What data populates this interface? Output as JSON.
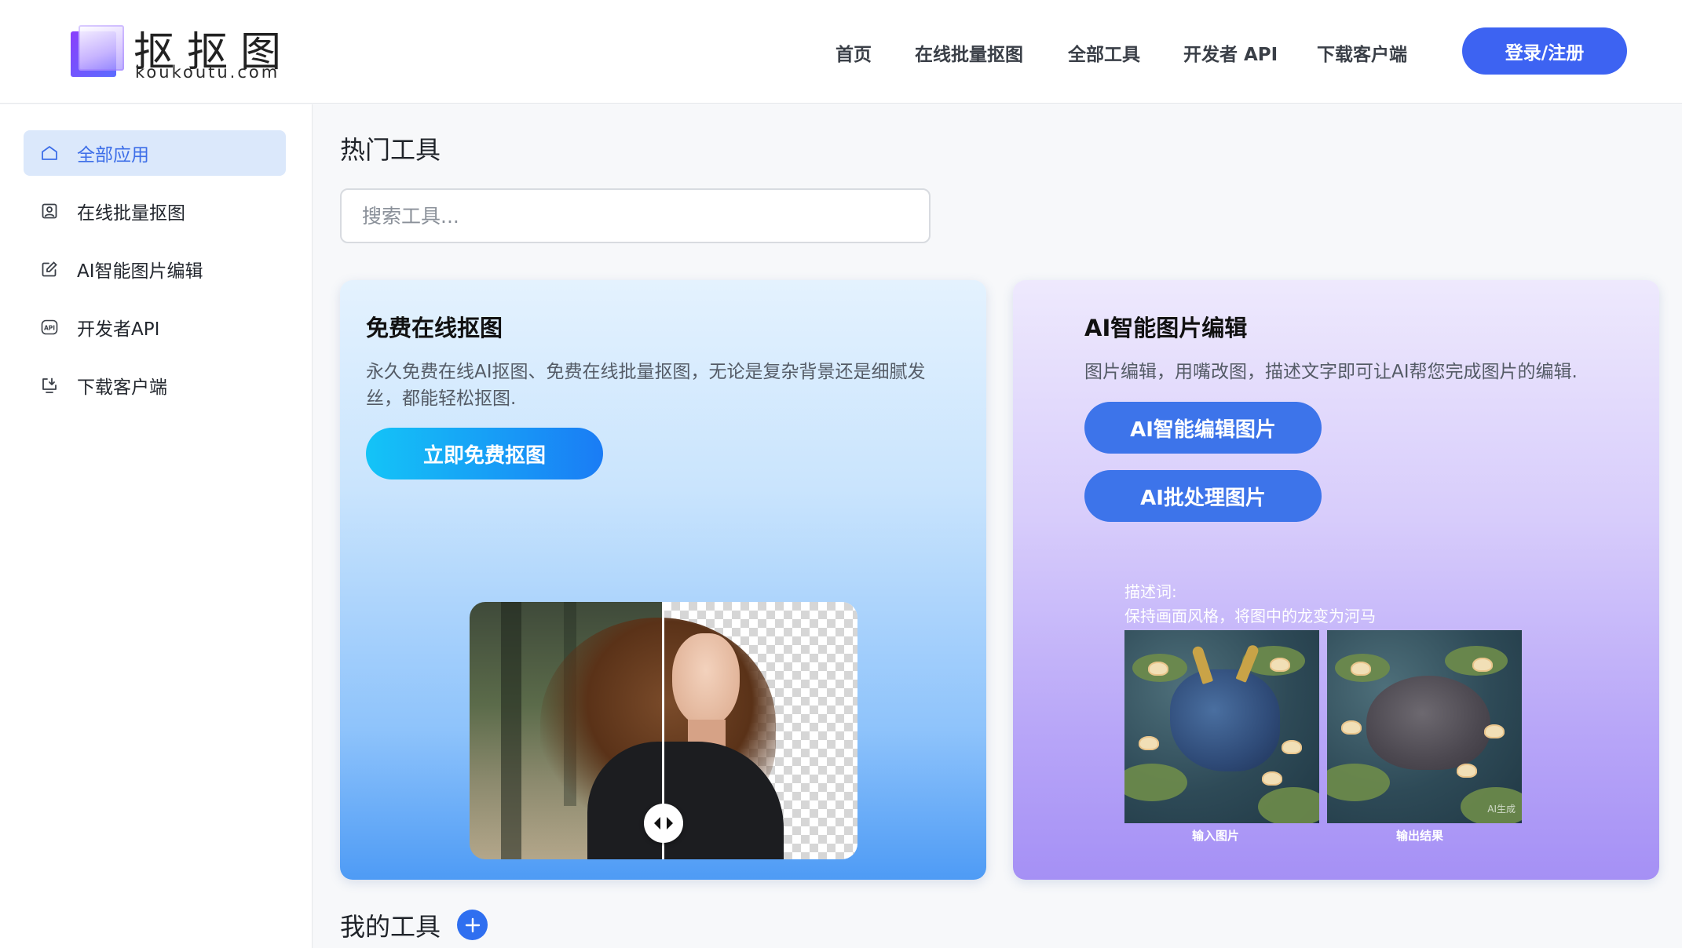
{
  "brand": {
    "name": "抠抠图",
    "domain": "koukoutu.com",
    "logo_icon": "stacked-squares-logo-icon"
  },
  "nav": {
    "items": [
      "首页",
      "在线批量抠图",
      "全部工具",
      "开发者 API",
      "下载客户端"
    ],
    "login_label": "登录/注册"
  },
  "sidebar": {
    "items": [
      {
        "label": "全部应用",
        "icon": "home-icon",
        "active": true
      },
      {
        "label": "在线批量抠图",
        "icon": "portrait-frame-icon",
        "active": false
      },
      {
        "label": "AI智能图片编辑",
        "icon": "edit-square-icon",
        "active": false
      },
      {
        "label": "开发者API",
        "icon": "api-icon",
        "active": false
      },
      {
        "label": "下载客户端",
        "icon": "download-monitor-icon",
        "active": false
      }
    ]
  },
  "main": {
    "hot_title": "热门工具",
    "search_placeholder": "搜索工具...",
    "my_tools_title": "我的工具"
  },
  "cards": {
    "left": {
      "title": "免费在线抠图",
      "desc": "永久免费在线AI抠图、免费在线批量抠图，无论是复杂背景还是细腻发丝，都能轻松抠图.",
      "button": "立即免费抠图"
    },
    "right": {
      "title": "AI智能图片编辑",
      "desc": "图片编辑，用嘴改图，描述文字即可让AI帮您完成图片的编辑.",
      "button_primary": "AI智能编辑图片",
      "button_secondary": "AI批处理图片",
      "prompt_label": "描述词:",
      "prompt_text": "保持画面风格，将图中的龙变为河马",
      "input_caption": "输入图片",
      "output_caption": "输出结果",
      "ai_badge": "AI生成"
    }
  },
  "colors": {
    "accent": "#3d63f2",
    "sidebar_active_bg": "#dbe8fb",
    "sidebar_active_text": "#3d6ee8",
    "card_left_bottom": "#4e9bf5",
    "card_right_bottom": "#a590f5"
  }
}
